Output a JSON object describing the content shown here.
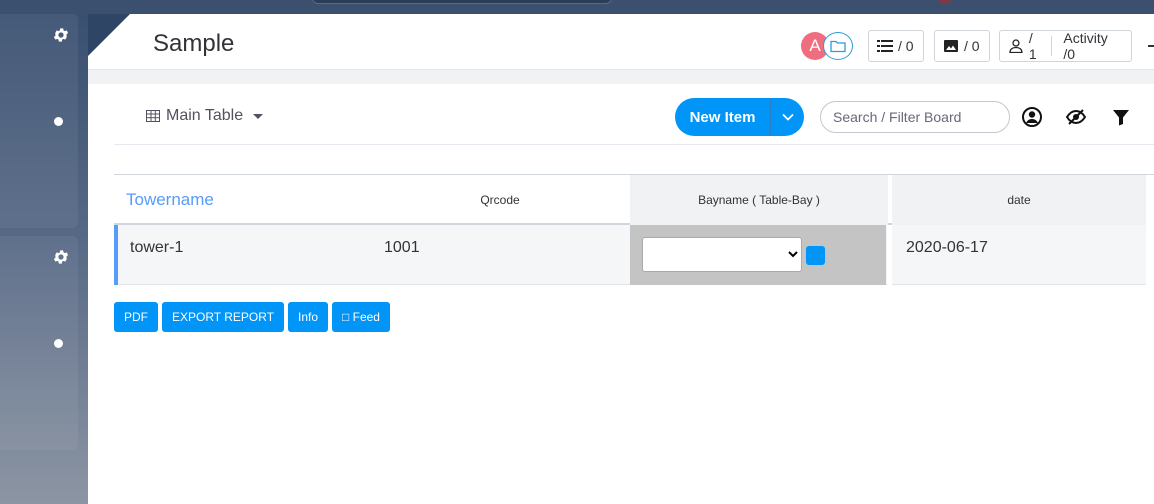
{
  "board": {
    "title": "Sample"
  },
  "header": {
    "avatar_letter": "A",
    "updates_count": "/ 0",
    "files_count": "/ 0",
    "members_count": "/ 1",
    "activity_label": "Activity /0"
  },
  "toolbar": {
    "view_label": "Main Table",
    "new_item_label": "New Item",
    "search_placeholder": "Search / Filter Board"
  },
  "table": {
    "columns": [
      "Towername",
      "Qrcode",
      "Bayname ( Table-Bay )",
      "date"
    ],
    "rows": [
      {
        "tower": "tower-1",
        "qrcode": "1001",
        "bayname": "",
        "date": "2020-06-17"
      }
    ]
  },
  "buttons": {
    "pdf": "PDF",
    "export": "EXPORT REPORT",
    "info": "Info",
    "feed": "□ Feed"
  },
  "colors": {
    "accent": "#0095f7",
    "group": "#579bfc",
    "avatar": "#ee6d7e"
  }
}
